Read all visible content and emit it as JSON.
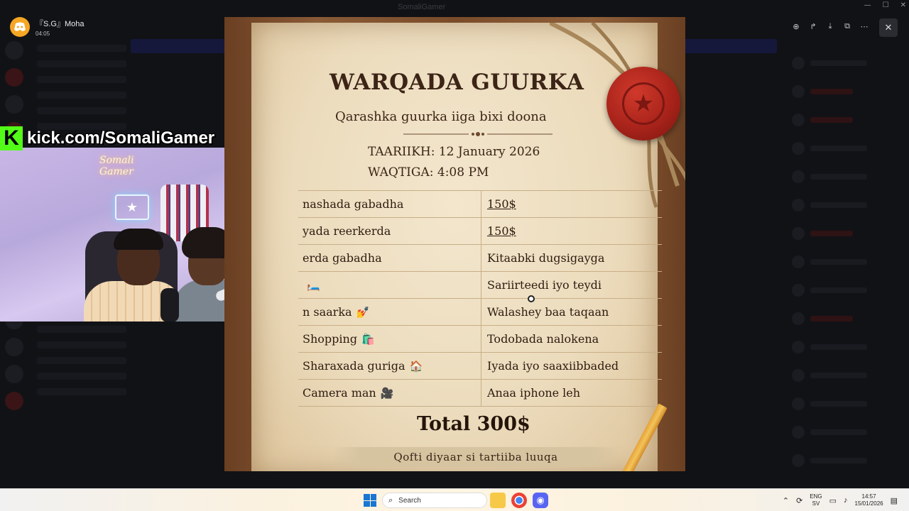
{
  "window": {
    "title": "SomaliGamer"
  },
  "user": {
    "name": "『S.G』Moha",
    "time": "04:05"
  },
  "viewer_tools": [
    "zoom-icon",
    "forward-icon",
    "download-icon",
    "open-external-icon",
    "more-icon"
  ],
  "stream": {
    "kick_logo": "K",
    "kick_url": "kick.com/SomaliGamer",
    "neon_text": "Somali Gamer"
  },
  "document": {
    "title": "WARQADA GUURKA",
    "subtitle": "Qarashka guurka iiga bixi doona",
    "date": "TAARIIKH: 12 January 2026",
    "time": "WAQTIGA: 4:08 PM",
    "rows": [
      {
        "left": "nashada gabadha",
        "right": "150$",
        "emoji": ""
      },
      {
        "left": "yada reerkerda",
        "right": "150$",
        "emoji": ""
      },
      {
        "left": "erda gabadha",
        "right": "Kitaabki dugsigayga",
        "emoji": ""
      },
      {
        "left": "",
        "right": "Sariirteedi iyo teydi",
        "emoji": "🛏️"
      },
      {
        "left": "n saarka",
        "right": "Walashey baa taqaan",
        "emoji": "💅"
      },
      {
        "left": "Shopping",
        "right": "Todobada nalokena",
        "emoji": "🛍️"
      },
      {
        "left": "Sharaxada guriga",
        "right": "Iyada iyo saaxiibbaded",
        "emoji": "🏠"
      },
      {
        "left": "Camera man",
        "right": "Anaa iphone leh",
        "emoji": "🎥"
      }
    ],
    "total": "Total 300$",
    "footer": "Qofti diyaar si tartiiba luuqa"
  },
  "taskbar": {
    "search_placeholder": "Search",
    "lang_top": "ENG",
    "lang_bottom": "SV",
    "clock_time": "14:57",
    "clock_date": "15/01/2026"
  },
  "colors": {
    "kick_green": "#53fc18",
    "discord_blurple": "#5865f2",
    "seal_red": "#a8231a"
  }
}
